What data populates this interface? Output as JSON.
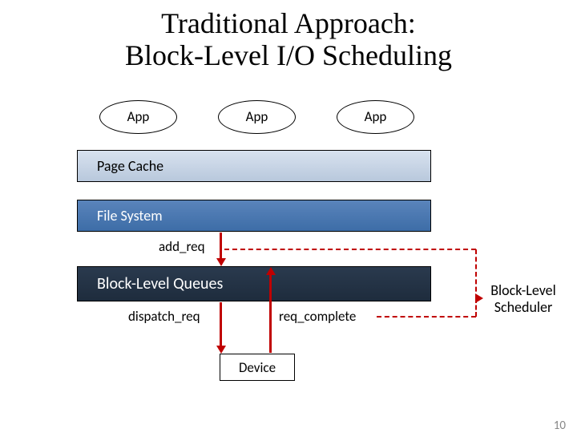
{
  "title_line1": "Traditional Approach:",
  "title_line2": "Block-Level I/O Scheduling",
  "apps": {
    "a1": "App",
    "a2": "App",
    "a3": "App"
  },
  "layers": {
    "page_cache": "Page Cache",
    "file_system": "File System",
    "block_queues": "Block-Level Queues"
  },
  "labels": {
    "add_req": "add_req",
    "dispatch_req": "dispatch_req",
    "req_complete": "req_complete"
  },
  "device": "Device",
  "scheduler_line1": "Block-Level",
  "scheduler_line2": "Scheduler",
  "slide_number": "10"
}
